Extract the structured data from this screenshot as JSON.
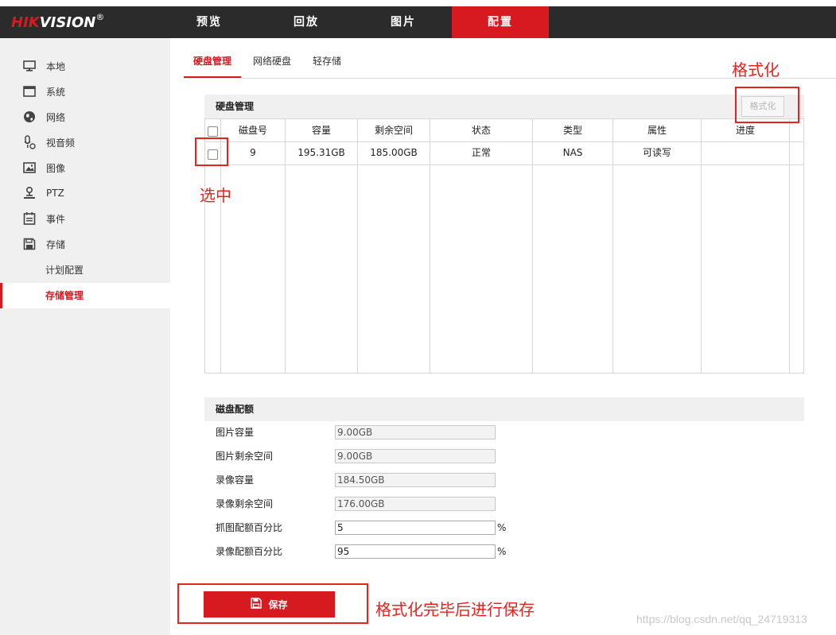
{
  "logo": {
    "brand_red": "HIK",
    "brand_white": "VISION",
    "reg": "®"
  },
  "nav": {
    "items": [
      "预览",
      "回放",
      "图片",
      "配置"
    ],
    "active_index": 3
  },
  "sidebar": {
    "items": [
      {
        "label": "本地",
        "icon": "monitor-icon"
      },
      {
        "label": "系统",
        "icon": "window-icon"
      },
      {
        "label": "网络",
        "icon": "globe-icon"
      },
      {
        "label": "视音频",
        "icon": "mic-camera-icon"
      },
      {
        "label": "图像",
        "icon": "image-icon"
      },
      {
        "label": "PTZ",
        "icon": "ptz-person-icon"
      },
      {
        "label": "事件",
        "icon": "calendar-icon"
      },
      {
        "label": "存储",
        "icon": "floppy-icon"
      }
    ],
    "sub_items": [
      "计划配置",
      "存储管理"
    ],
    "active_sub_index": 1
  },
  "tabs": {
    "items": [
      "硬盘管理",
      "网络硬盘",
      "轻存储"
    ],
    "active_index": 0
  },
  "disk_section": {
    "title": "硬盘管理",
    "format_button": "格式化",
    "columns": [
      "磁盘号",
      "容量",
      "剩余空间",
      "状态",
      "类型",
      "属性",
      "进度"
    ],
    "rows": [
      {
        "disk_no": "9",
        "capacity": "195.31GB",
        "free": "185.00GB",
        "status": "正常",
        "type": "NAS",
        "attribute": "可读写",
        "progress": ""
      }
    ]
  },
  "quota_section": {
    "title": "磁盘配额",
    "fields": [
      {
        "label": "图片容量",
        "value": "9.00GB",
        "unit": ""
      },
      {
        "label": "图片剩余空间",
        "value": "9.00GB",
        "unit": ""
      },
      {
        "label": "录像容量",
        "value": "184.50GB",
        "unit": ""
      },
      {
        "label": "录像剩余空间",
        "value": "176.00GB",
        "unit": ""
      },
      {
        "label": "抓图配额百分比",
        "value": "5",
        "unit": "%"
      },
      {
        "label": "录像配额百分比",
        "value": "95",
        "unit": "%"
      }
    ]
  },
  "save_button": "保存",
  "annotations": {
    "format_note": "格式化",
    "select_note": "选中",
    "save_note": "格式化完毕后进行保存",
    "color": "#e8231e"
  },
  "watermark": "https://blog.csdn.net/qq_24719313",
  "colors": {
    "accent": "#d71920",
    "topbar": "#2b2b2b",
    "sidebar": "#f0f0f0"
  }
}
